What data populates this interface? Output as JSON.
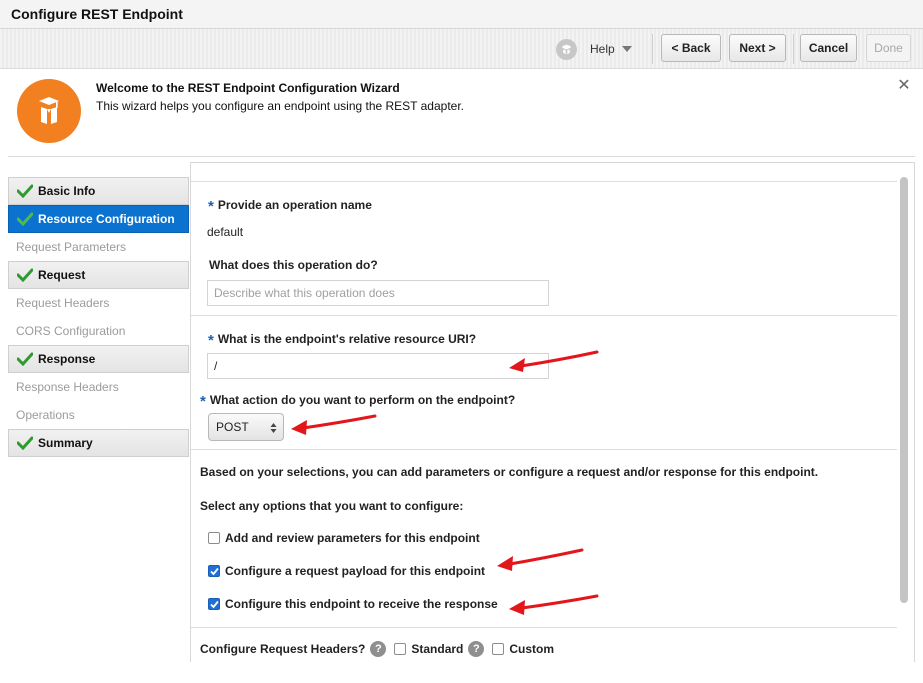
{
  "window": {
    "title": "Configure REST Endpoint"
  },
  "toolbar": {
    "help_label": "Help",
    "back_label": "< Back",
    "next_label": "Next >",
    "cancel_label": "Cancel",
    "done_label": "Done"
  },
  "welcome": {
    "title": "Welcome to the REST Endpoint Configuration Wizard",
    "subtitle": "This wizard helps you configure an endpoint using the REST adapter."
  },
  "nav": {
    "items": [
      {
        "label": "Basic Info",
        "state": "done"
      },
      {
        "label": "Resource Configuration",
        "state": "active"
      },
      {
        "label": "Request Parameters",
        "state": "pending"
      },
      {
        "label": "Request",
        "state": "done"
      },
      {
        "label": "Request Headers",
        "state": "pending"
      },
      {
        "label": "CORS Configuration",
        "state": "pending"
      },
      {
        "label": "Response",
        "state": "done"
      },
      {
        "label": "Response Headers",
        "state": "pending"
      },
      {
        "label": "Operations",
        "state": "pending"
      },
      {
        "label": "Summary",
        "state": "done"
      }
    ]
  },
  "form": {
    "required_marker": "*",
    "operation_name_label": "Provide an operation name",
    "operation_name_value": "default",
    "operation_desc_label": "What does this operation do?",
    "operation_desc_placeholder": "Describe what this operation does",
    "uri_label": "What is the endpoint's relative resource URI?",
    "uri_value": "/",
    "action_label": "What action do you want to perform on the endpoint?",
    "action_value": "POST",
    "selections_text": "Based on your selections, you can add parameters or configure a request and/or response for this endpoint.",
    "options_text": "Select any options that you want to configure:",
    "opt_params_label": "Add and review parameters for this endpoint",
    "opt_params_checked": false,
    "opt_request_label": "Configure a request payload for this endpoint",
    "opt_request_checked": true,
    "opt_response_label": "Configure this endpoint to receive the response",
    "opt_response_checked": true,
    "headers_label": "Configure Request Headers?",
    "help_glyph": "?",
    "standard_label": "Standard",
    "standard_checked": false,
    "custom_label": "Custom",
    "custom_checked": false
  },
  "colors": {
    "accent": "#0b72d0",
    "logo": "#f27f20",
    "annotation_arrow": "#e3161b"
  }
}
